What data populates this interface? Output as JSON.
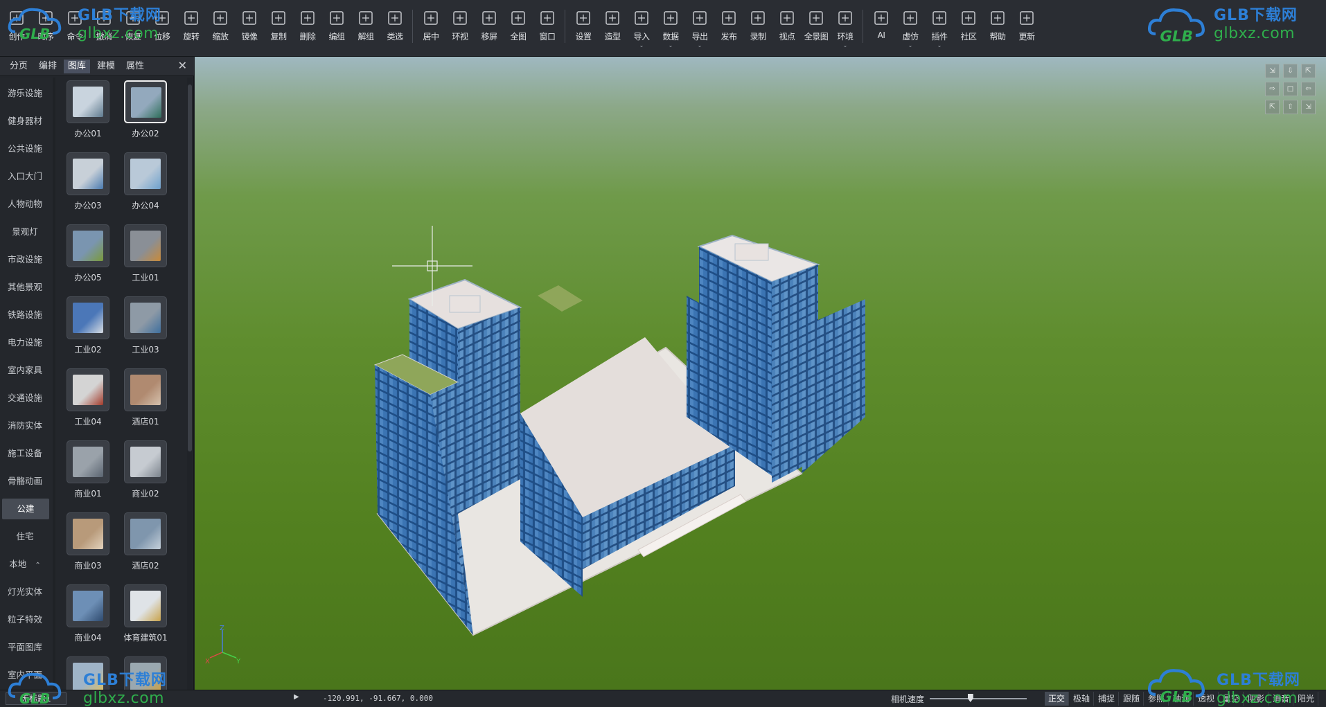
{
  "toolbar": {
    "groups": [
      [
        {
          "label": "创作",
          "icon": "new-doc-icon"
        },
        {
          "label": "时序",
          "icon": "timeline-icon"
        },
        {
          "label": "命令",
          "icon": "command-icon"
        },
        {
          "label": "撤消",
          "icon": "undo-icon"
        },
        {
          "label": "恢复",
          "icon": "redo-icon"
        },
        {
          "label": "位移",
          "icon": "move-icon"
        },
        {
          "label": "旋转",
          "icon": "rotate-icon"
        },
        {
          "label": "缩放",
          "icon": "scale-icon"
        },
        {
          "label": "镜像",
          "icon": "mirror-icon"
        },
        {
          "label": "复制",
          "icon": "copy-icon"
        },
        {
          "label": "删除",
          "icon": "delete-icon"
        },
        {
          "label": "编组",
          "icon": "group-icon"
        },
        {
          "label": "解组",
          "icon": "ungroup-icon"
        },
        {
          "label": "类选",
          "icon": "class-select-icon"
        }
      ],
      [
        {
          "label": "居中",
          "icon": "center-icon"
        },
        {
          "label": "环视",
          "icon": "orbit-icon"
        },
        {
          "label": "移屏",
          "icon": "pan-hand-icon"
        },
        {
          "label": "全图",
          "icon": "zoom-extents-icon"
        },
        {
          "label": "窗口",
          "icon": "zoom-window-icon"
        }
      ],
      [
        {
          "label": "设置",
          "icon": "settings-icon"
        },
        {
          "label": "造型",
          "icon": "modeling-icon"
        },
        {
          "label": "导入",
          "icon": "import-icon",
          "caret": true
        },
        {
          "label": "数据",
          "icon": "data-icon",
          "caret": true
        },
        {
          "label": "导出",
          "icon": "export-icon",
          "caret": true
        },
        {
          "label": "发布",
          "icon": "publish-icon"
        },
        {
          "label": "录制",
          "icon": "record-icon"
        },
        {
          "label": "视点",
          "icon": "viewpoint-icon"
        },
        {
          "label": "全景图",
          "icon": "panorama-icon"
        },
        {
          "label": "环境",
          "icon": "environment-sun-icon",
          "caret": true
        }
      ],
      [
        {
          "label": "AI",
          "icon": "ai-icon"
        },
        {
          "label": "虚仿",
          "icon": "vr-icon",
          "caret": true
        },
        {
          "label": "插件",
          "icon": "plugin-icon",
          "caret": true
        },
        {
          "label": "社区",
          "icon": "community-icon"
        },
        {
          "label": "帮助",
          "icon": "help-handshake-icon"
        },
        {
          "label": "更新",
          "icon": "update-icon"
        }
      ]
    ]
  },
  "watermark": {
    "line1": "GLB下载网",
    "line2": "glbxz.com",
    "logo": "GLB"
  },
  "panel": {
    "tabs": [
      "分页",
      "编排",
      "图库",
      "建模",
      "属性"
    ],
    "active_tab": 2,
    "close_glyph": "✕",
    "categories": [
      {
        "label": "游乐设施"
      },
      {
        "label": "健身器材"
      },
      {
        "label": "公共设施"
      },
      {
        "label": "入口大门"
      },
      {
        "label": "人物动物"
      },
      {
        "label": "景观灯"
      },
      {
        "label": "市政设施"
      },
      {
        "label": "其他景观"
      },
      {
        "label": "铁路设施"
      },
      {
        "label": "电力设施"
      },
      {
        "label": "室内家具"
      },
      {
        "label": "交通设施"
      },
      {
        "label": "消防实体"
      },
      {
        "label": "施工设备"
      },
      {
        "label": "骨骼动画"
      },
      {
        "label": "公建",
        "active": true
      },
      {
        "label": "住宅"
      },
      {
        "label": "本地",
        "caret": "⌃"
      },
      {
        "label": "灯光实体"
      },
      {
        "label": "粒子特效"
      },
      {
        "label": "平面图库"
      },
      {
        "label": "室内平面"
      }
    ],
    "thumbnails": [
      {
        "label": "办公01",
        "color": "#c9d4de",
        "accent": "#5f7a8e"
      },
      {
        "label": "办公02",
        "color": "#93a9bd",
        "accent": "#2e6e5a",
        "selected": true
      },
      {
        "label": "办公03",
        "color": "#c8d0d8",
        "accent": "#4a7bb0"
      },
      {
        "label": "办公04",
        "color": "#b9c9d8",
        "accent": "#6ea0cc"
      },
      {
        "label": "办公05",
        "color": "#7a95b0",
        "accent": "#7a9a3a"
      },
      {
        "label": "工业01",
        "color": "#8a8f96",
        "accent": "#c88a3a"
      },
      {
        "label": "工业02",
        "color": "#4b77b8",
        "accent": "#d8dde3"
      },
      {
        "label": "工业03",
        "color": "#8e9aa6",
        "accent": "#3f6f9e"
      },
      {
        "label": "工业04",
        "color": "#d4d4d4",
        "accent": "#a33a2a"
      },
      {
        "label": "酒店01",
        "color": "#b08a70",
        "accent": "#d6c2ae"
      },
      {
        "label": "商业01",
        "color": "#9aa2aa",
        "accent": "#5a6470"
      },
      {
        "label": "商业02",
        "color": "#c6cbd1",
        "accent": "#7b838c"
      },
      {
        "label": "商业03",
        "color": "#b89a7a",
        "accent": "#e2d2bd"
      },
      {
        "label": "酒店02",
        "color": "#7f96ad",
        "accent": "#c5d0da"
      },
      {
        "label": "商业04",
        "color": "#6d8fb6",
        "accent": "#2e4a6e"
      },
      {
        "label": "体育建筑01",
        "color": "#dfe3e7",
        "accent": "#c9a34a"
      },
      {
        "label": "",
        "color": "#9fb4c8",
        "accent": "#e0c060"
      },
      {
        "label": "",
        "color": "#9aa8b0",
        "accent": "#d2a13a"
      }
    ]
  },
  "viewport": {
    "nav_cube": [
      "⇲",
      "⇩",
      "⇱",
      "⇨",
      "□",
      "⇦",
      "⇱",
      "⇧",
      "⇲"
    ],
    "axes": {
      "x": "X",
      "y": "Y",
      "z": "Z"
    }
  },
  "statusbar": {
    "doc_name": "无标题1",
    "coords": "-120.991, -91.667, 0.000",
    "camera_speed_label": "相机速度",
    "camera_speed_value": 0.42,
    "toggles": [
      {
        "label": "正交",
        "on": true
      },
      {
        "label": "极轴",
        "on": false
      },
      {
        "label": "捕捉",
        "on": false
      },
      {
        "label": "跟随",
        "on": false
      },
      {
        "label": "参照",
        "on": false
      },
      {
        "label": "轴测",
        "on": false
      },
      {
        "label": "透视",
        "on": false
      },
      {
        "label": "星空",
        "on": false
      },
      {
        "label": "阴影",
        "on": false
      },
      {
        "label": "消音",
        "on": false
      },
      {
        "label": "阳光",
        "on": false
      }
    ]
  }
}
